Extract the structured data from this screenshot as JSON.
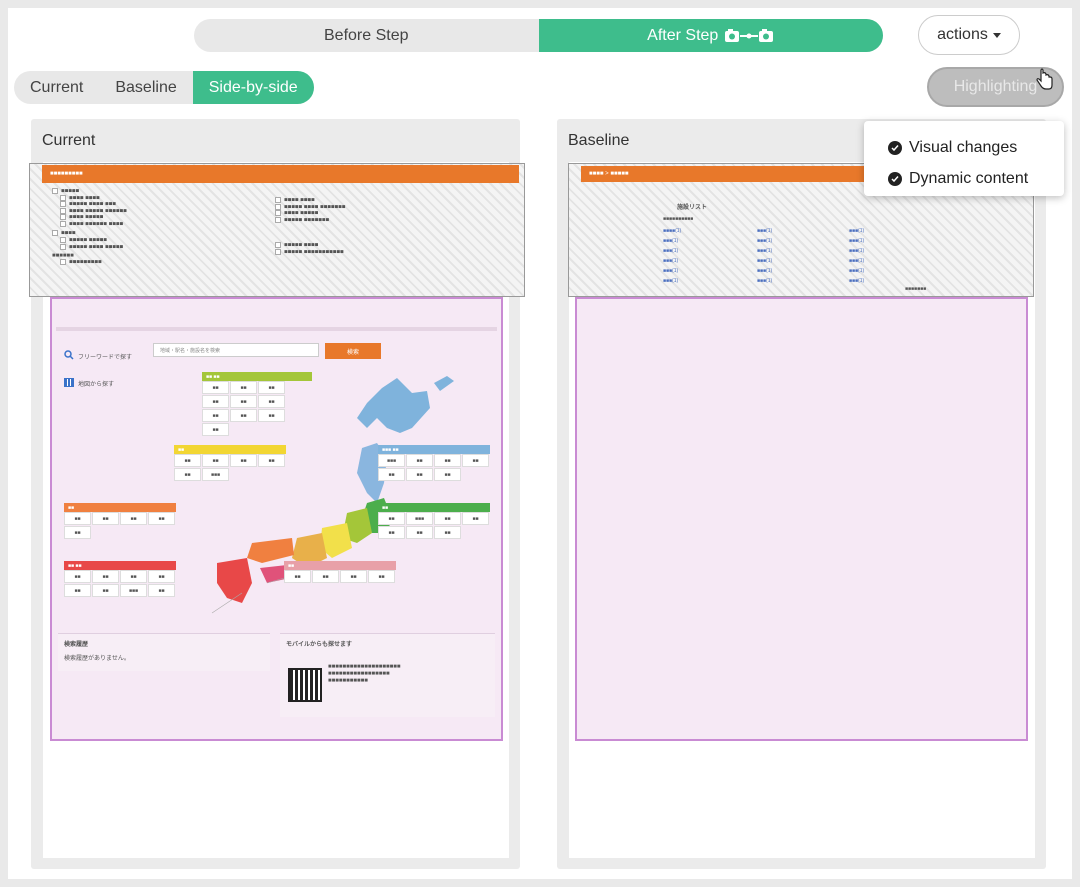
{
  "step_toggle": {
    "before_label": "Before Step",
    "after_label": "After Step",
    "active": "after"
  },
  "actions_label": "actions",
  "view_toggle": {
    "items": [
      "Current",
      "Baseline",
      "Side-by-side"
    ],
    "active": "Side-by-side"
  },
  "highlight_label": "Highlighting",
  "highlight_menu": {
    "items": [
      "Visual changes",
      "Dynamic content"
    ]
  },
  "panels": {
    "current_title": "Current",
    "baseline_title": "Baseline"
  },
  "current_page": {
    "search_placeholder": "地域・駅名・施設名を検索",
    "search_button": "検索",
    "search_label": "フリーワードで探す",
    "map_label": "地図から探す",
    "history_title": "検索履歴",
    "history_empty": "検索履歴がありません。",
    "mobile_title": "モバイルからも探せます"
  },
  "baseline_page": {
    "list_title": "施設リスト"
  },
  "colors": {
    "accent_green": "#3ebd8c",
    "orange": "#e8782a",
    "highlight_pink": "#c98bd3"
  }
}
